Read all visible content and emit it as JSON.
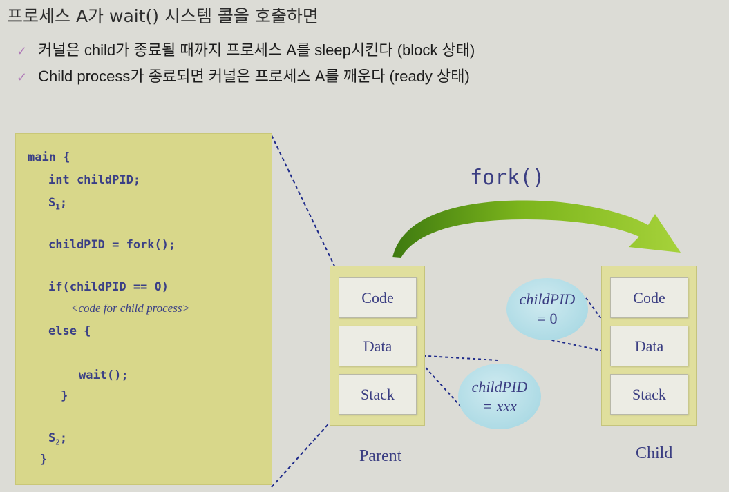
{
  "slide": {
    "title": "프로세스 A가 wait() 시스템 콜을 호출하면",
    "bullets": [
      "커널은 child가 종료될 때까지 프로세스 A를 sleep시킨다 (block 상태)",
      "Child process가 종료되면 커널은 프로세스 A를 깨운다 (ready 상태)"
    ],
    "check_glyph": "✓"
  },
  "code": {
    "lines": [
      "main {",
      "int childPID;",
      "S",
      "childPID = fork();",
      "if(childPID == 0)",
      "<code for child process>",
      "else {",
      "wait();",
      "}",
      "S",
      "}"
    ],
    "s1_subscript": "1",
    "s1_suffix": ";",
    "s2_subscript": "2",
    "s2_suffix": ";"
  },
  "diagram": {
    "fork_label": "fork()",
    "parent": {
      "label": "Parent",
      "segments": [
        "Code",
        "Data",
        "Stack"
      ]
    },
    "child": {
      "label": "Child",
      "segments": [
        "Code",
        "Data",
        "Stack"
      ]
    },
    "child_bubble": {
      "var": "childPID",
      "value": "= 0"
    },
    "parent_bubble": {
      "var": "childPID",
      "value": "= xxx"
    }
  },
  "colors": {
    "panel": "#d8d78a",
    "text_blue": "#3b3e82",
    "arrow_green": "#8bc21e",
    "bubble": "#aedbe5",
    "check": "#b07ab8"
  }
}
